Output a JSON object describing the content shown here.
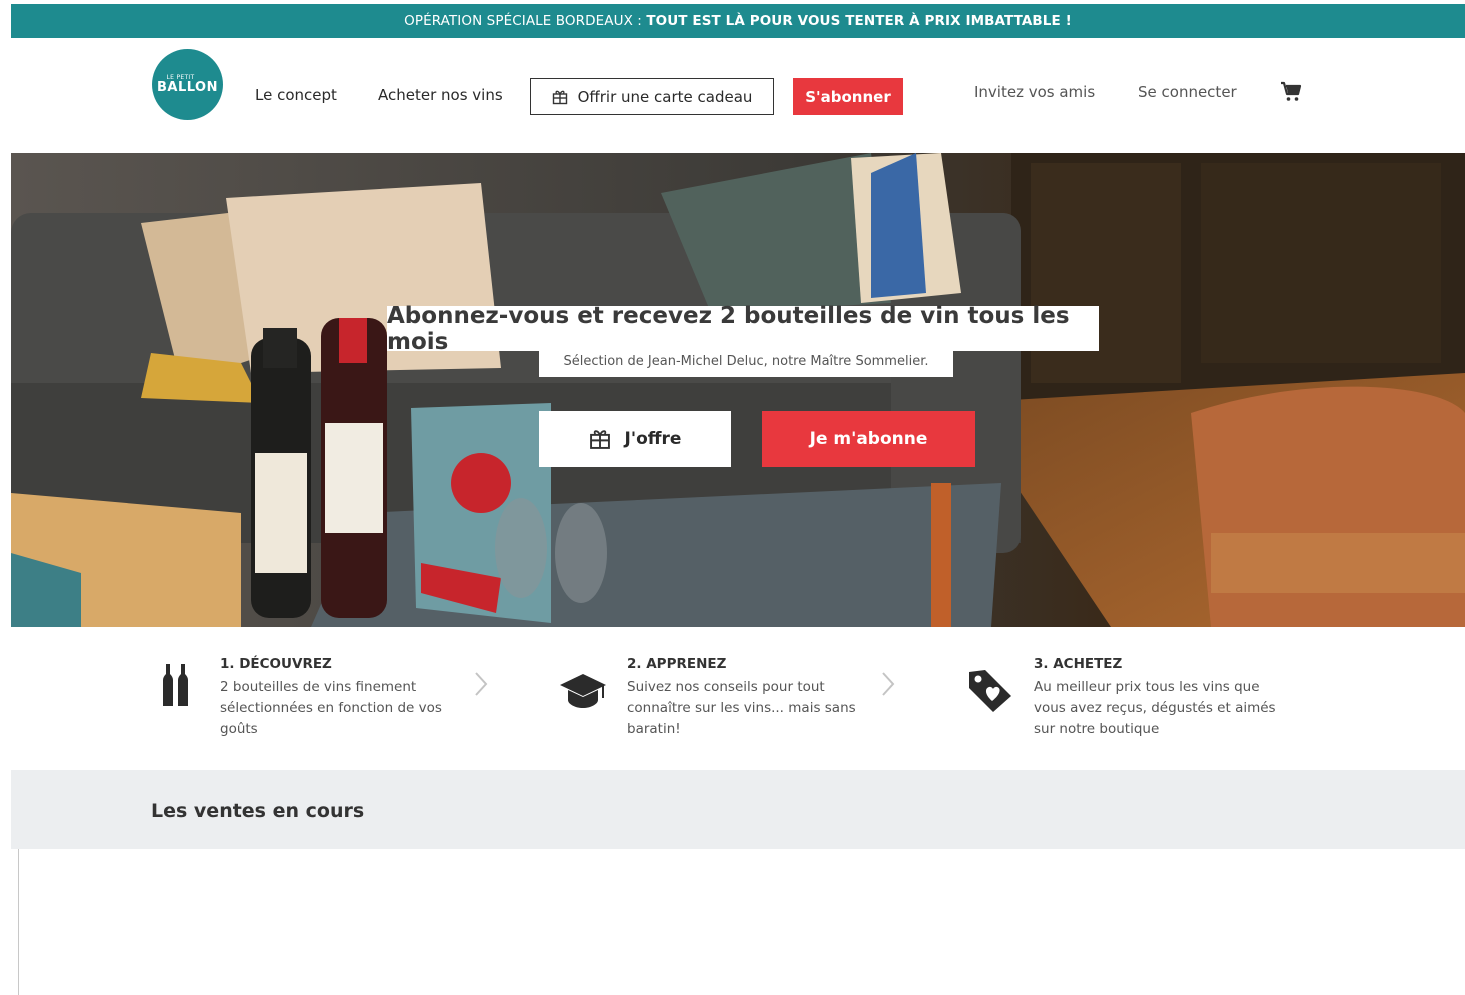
{
  "promo": {
    "lead": "OPÉRATION SPÉCIALE BORDEAUX : ",
    "strong": "TOUT EST LÀ POUR VOUS TENTER À PRIX IMBATTABLE !"
  },
  "header": {
    "logo_small": "LE PETIT",
    "logo_big": "BALLON",
    "nav": {
      "concept": "Le concept",
      "acheter": "Acheter nos vins",
      "gift": "Offrir une carte cadeau",
      "subscribe": "S'abonner",
      "invite": "Invitez vos amis",
      "connect": "Se connecter"
    }
  },
  "hero": {
    "title": "Abonnez-vous et recevez 2 bouteilles de vin tous les mois",
    "subtitle": "Sélection de Jean-Michel Deluc, notre Maître Sommelier.",
    "offer_button": "J'offre",
    "subscribe_button": "Je m'abonne"
  },
  "steps": [
    {
      "title": "1. DÉCOUVREZ",
      "lines": [
        "2 bouteilles de vins finement",
        "sélectionnées en fonction de vos",
        "goûts"
      ],
      "icon": "bottles-icon"
    },
    {
      "title": "2. APPRENEZ",
      "lines": [
        "Suivez nos conseils pour tout",
        "connaître sur les vins... mais sans",
        "baratin!"
      ],
      "icon": "graduation-cap-icon"
    },
    {
      "title": "3. ACHETEZ",
      "lines": [
        "Au meilleur prix tous les vins que",
        "vous avez reçus, dégustés et aimés",
        "sur notre boutique"
      ],
      "icon": "tag-heart-icon"
    }
  ],
  "ventes": {
    "title": "Les ventes en cours"
  },
  "colors": {
    "teal": "#1e8b8f",
    "red": "#e8383e",
    "grey_bg": "#eceef0"
  }
}
